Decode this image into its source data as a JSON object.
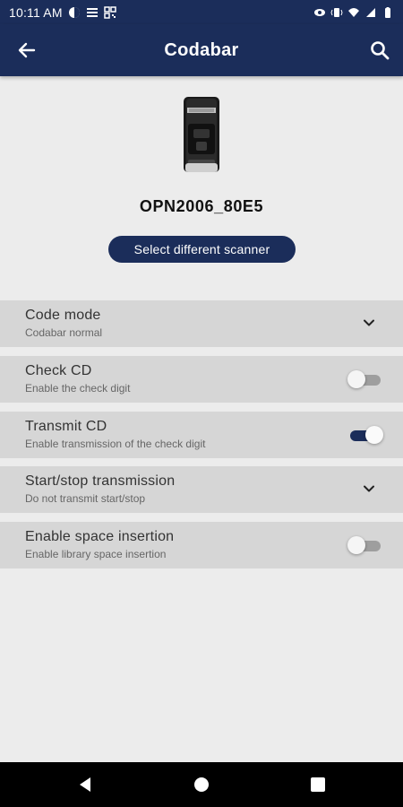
{
  "status_bar": {
    "time": "10:11 AM"
  },
  "app_bar": {
    "title": "Codabar"
  },
  "device": {
    "name": "OPN2006_80E5",
    "select_label": "Select different scanner"
  },
  "settings": [
    {
      "title": "Code mode",
      "subtitle": "Codabar normal",
      "control": "dropdown"
    },
    {
      "title": "Check CD",
      "subtitle": "Enable the check digit",
      "control": "toggle",
      "on": false
    },
    {
      "title": "Transmit CD",
      "subtitle": "Enable transmission of the check digit",
      "control": "toggle",
      "on": true
    },
    {
      "title": "Start/stop transmission",
      "subtitle": "Do not transmit start/stop",
      "control": "dropdown"
    },
    {
      "title": "Enable space insertion",
      "subtitle": "Enable library space insertion",
      "control": "toggle",
      "on": false
    }
  ],
  "colors": {
    "primary": "#1b2d5a",
    "row_bg": "#d6d6d6",
    "page_bg": "#ececec"
  },
  "icons": {
    "back": "arrow-left-icon",
    "search": "search-icon",
    "chevron": "chevron-down-icon",
    "nav_back": "nav-back-icon",
    "nav_home": "nav-home-icon",
    "nav_recent": "nav-recent-icon"
  }
}
